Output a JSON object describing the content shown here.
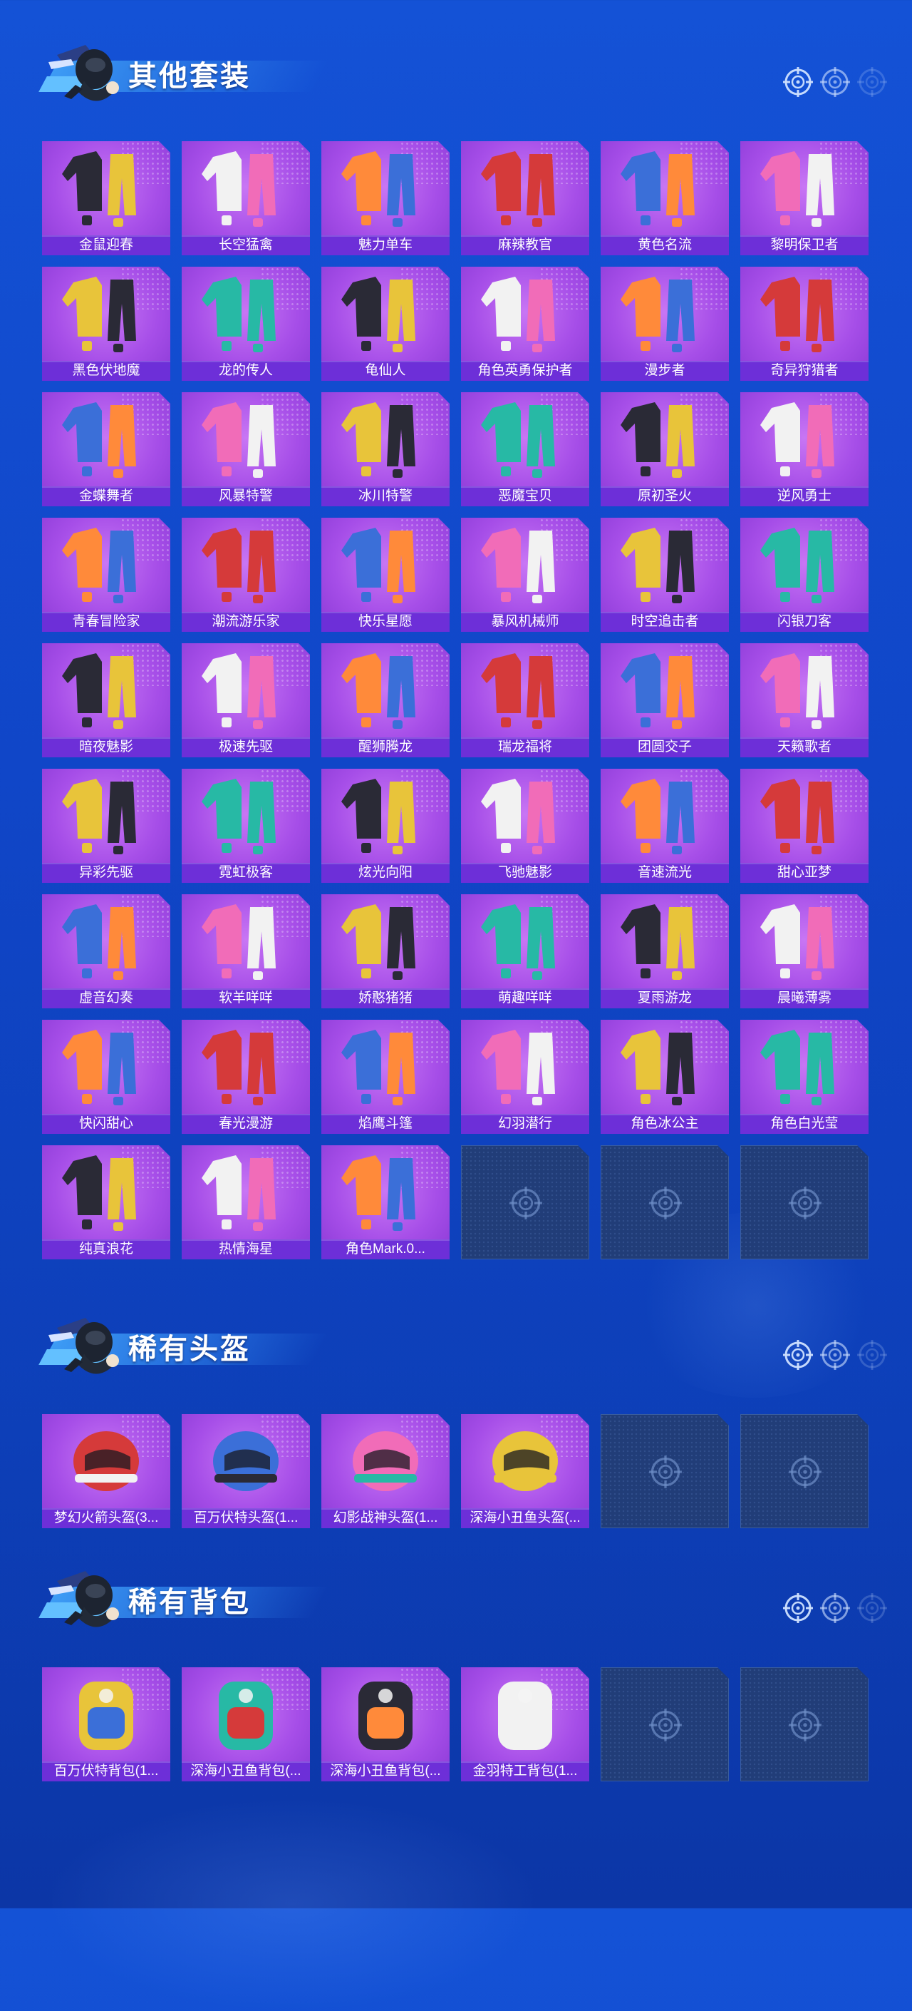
{
  "sections": [
    {
      "title": "其他套装",
      "items": [
        "金鼠迎春",
        "长空猛禽",
        "魅力单车",
        "麻辣教官",
        "黄色名流",
        "黎明保卫者",
        "黑色伏地魔",
        "龙的传人",
        "龟仙人",
        "角色英勇保护者",
        "漫步者",
        "奇异狩猎者",
        "金蝶舞者",
        "风暴特警",
        "冰川特警",
        "恶魔宝贝",
        "原初圣火",
        "逆风勇士",
        "青春冒险家",
        "潮流游乐家",
        "快乐星愿",
        "暴风机械师",
        "时空追击者",
        "闪银刀客",
        "暗夜魅影",
        "极速先驱",
        "醒狮腾龙",
        "瑞龙福将",
        "团圆交子",
        "天籁歌者",
        "异彩先驱",
        "霓虹极客",
        "炫光向阳",
        "飞驰魅影",
        "音速流光",
        "甜心亚梦",
        "虚音幻奏",
        "软羊咩咩",
        "娇憨猪猪",
        "萌趣咩咩",
        "夏雨游龙",
        "晨曦薄雾",
        "快闪甜心",
        "春光漫游",
        "焰鹰斗篷",
        "幻羽潜行",
        "角色冰公主",
        "角色白光莹",
        "纯真浪花",
        "热情海星",
        "角色Mark.0..."
      ],
      "empty_slots": 3
    },
    {
      "title": "稀有头盔",
      "items": [
        "梦幻火箭头盔(3...",
        "百万伏特头盔(1...",
        "幻影战神头盔(1...",
        "深海小丑鱼头盔(..."
      ],
      "empty_slots": 2
    },
    {
      "title": "稀有背包",
      "items": [
        "百万伏特背包(1...",
        "深海小丑鱼背包(...",
        "深海小丑鱼背包(...",
        "金羽特工背包(1..."
      ],
      "empty_slots": 2
    }
  ],
  "icons": {
    "empty_slot": "crosshair-icon",
    "header_decoration": "crosshair-icon",
    "mascot": "parachute-soldier-icon"
  },
  "colors": {
    "background": "#1452d6",
    "card": "#a64ee8",
    "label_bar": "#6d2fd8",
    "empty_card": "#213d78",
    "banner": "#3d9cf5"
  }
}
